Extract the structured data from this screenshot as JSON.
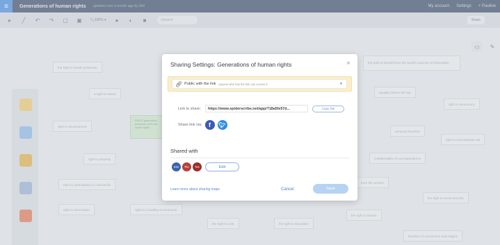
{
  "topbar": {
    "doc_title": "Generations of human rights",
    "saved_status": "updated over a month ago by Ifell",
    "my_account": "My account",
    "settings": "Settings",
    "user": "+ Pauline"
  },
  "toolbar": {
    "zoom": "100% ▾",
    "search_placeholder": "Search",
    "share_label": "Share"
  },
  "canvas": {
    "nodes": [
      "the right to health protection",
      "a right to award",
      "right to development",
      "FIRST generation: personal, civil and social rights",
      "right to property",
      "right to participation in cultural life",
      "right to information",
      "right to a healthy environment",
      "the right to vote",
      "the right to education",
      "the right to benefit from the world's sources of information",
      "equality before the law",
      "right to democracy",
      "personal freedom",
      "right to humanitarian aid",
      "confidentiality of correspondence",
      "from the archive",
      "the right to social security",
      "the right to leisure",
      "freedom of conscience and religion"
    ]
  },
  "modal": {
    "title": "Sharing Settings: Generations of human rights",
    "close": "×",
    "visibility_label": "Public with the link",
    "visibility_sub": "anyone who has the link can access it",
    "link_label": "Link to share:",
    "link_value": "https://www.spiderscribe.net/app/?18a5fe57d...",
    "copy_label": "Copy link",
    "share_via_label": "Share link via:",
    "shared_with_title": "Shared with",
    "avatars": [
      "Kim",
      "Pio",
      "Tes"
    ],
    "edit_label": "Edit",
    "learn_more": "Learn more about sharing maps",
    "cancel_label": "Cancel",
    "save_label": "Save"
  },
  "colors": {
    "accent": "#4a8fe0",
    "topbar": "#3f4f6b",
    "visibility_bg": "#fbefc8",
    "avatar_kim": "#3b63a8",
    "avatar_pio": "#b5413a",
    "avatar_tes": "#9a2f2a"
  }
}
